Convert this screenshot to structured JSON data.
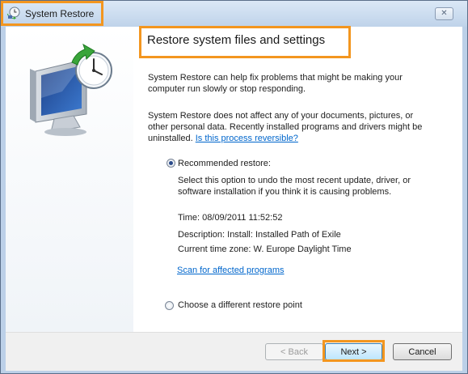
{
  "window": {
    "title": "System Restore",
    "close_glyph": "✕",
    "icons": {
      "title": "system-restore-icon",
      "hero": "system-restore-computer-clock-icon"
    }
  },
  "main": {
    "heading": "Restore system files and settings",
    "intro": "System Restore can help fix problems that might be making your computer run slowly or stop responding.",
    "note": "System Restore does not affect any of your documents, pictures, or other personal data. Recently installed programs and drivers might be uninstalled.",
    "reversible_link": "Is this process reversible?",
    "options": {
      "recommended": {
        "label": "Recommended restore:",
        "selected": true,
        "description": "Select this option to undo the most recent update, driver, or software installation if you think it is causing problems.",
        "time": "Time: 08/09/2011 11:52:52",
        "desc_line": "Description: Install: Installed Path of Exile",
        "timezone": "Current time zone: W. Europe Daylight Time",
        "scan_link": "Scan for affected programs"
      },
      "different": {
        "label": "Choose a different restore point",
        "selected": false
      }
    }
  },
  "footer": {
    "back_label": "< Back",
    "next_label": "Next >",
    "cancel_label": "Cancel"
  },
  "colors": {
    "highlight": "#f3961f",
    "link": "#0066cc"
  }
}
